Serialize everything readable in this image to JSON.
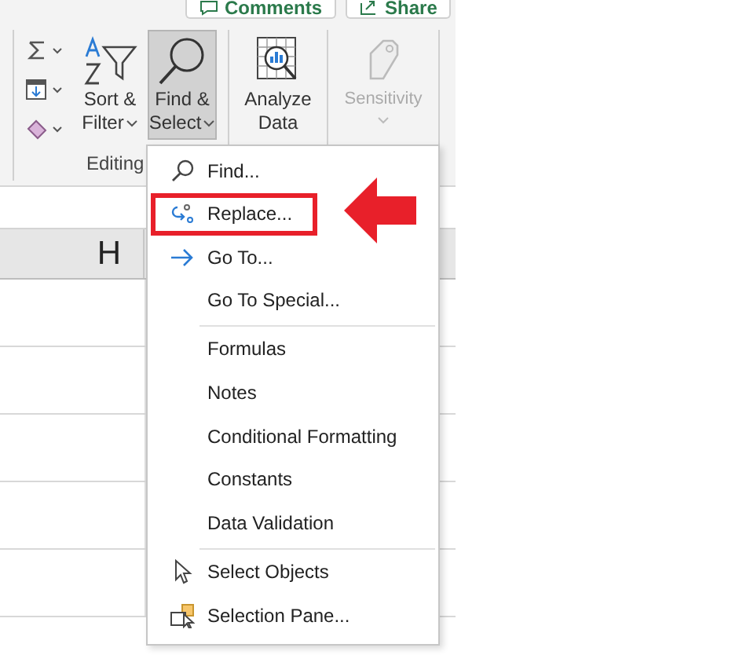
{
  "ribbon": {
    "top_buttons": [
      {
        "label": "Comments",
        "kind": "comments"
      },
      {
        "label": "Share",
        "kind": "share"
      }
    ],
    "groups": [
      {
        "label": "Editing",
        "buttons": [
          {
            "kind": "sort",
            "lines": [
              "Sort &",
              "Filter"
            ],
            "pressed": false,
            "disabled": false
          },
          {
            "kind": "find",
            "lines": [
              "Find &",
              "Select"
            ],
            "pressed": true,
            "disabled": false
          }
        ]
      },
      {
        "buttons": [
          {
            "kind": "analyze",
            "lines": [
              "Analyze",
              "Data"
            ],
            "pressed": false,
            "disabled": false
          }
        ]
      },
      {
        "buttons": [
          {
            "kind": "sensitivity",
            "lines": [
              "Sensitivity"
            ],
            "pressed": false,
            "disabled": true
          }
        ]
      }
    ]
  },
  "sheet": {
    "column_header": "H"
  },
  "menu": {
    "items": [
      {
        "label": "Find...",
        "kind": "find",
        "highlighted": false,
        "separator_before": false
      },
      {
        "label": "Replace...",
        "kind": "replace",
        "highlighted": true,
        "separator_before": false
      },
      {
        "label": "Go To...",
        "kind": "goto",
        "highlighted": false,
        "separator_before": false
      },
      {
        "label": "Go To Special...",
        "kind": "plain",
        "highlighted": false,
        "separator_before": false
      },
      {
        "label": "Formulas",
        "kind": "plain",
        "highlighted": false,
        "separator_before": true
      },
      {
        "label": "Notes",
        "kind": "plain",
        "highlighted": false,
        "separator_before": false
      },
      {
        "label": "Conditional Formatting",
        "kind": "plain",
        "highlighted": false,
        "separator_before": false
      },
      {
        "label": "Constants",
        "kind": "plain",
        "highlighted": false,
        "separator_before": false
      },
      {
        "label": "Data Validation",
        "kind": "plain",
        "highlighted": false,
        "separator_before": false
      },
      {
        "label": "Select Objects",
        "kind": "select",
        "highlighted": false,
        "separator_before": true
      },
      {
        "label": "Selection Pane...",
        "kind": "pane",
        "highlighted": false,
        "separator_before": false
      }
    ]
  }
}
